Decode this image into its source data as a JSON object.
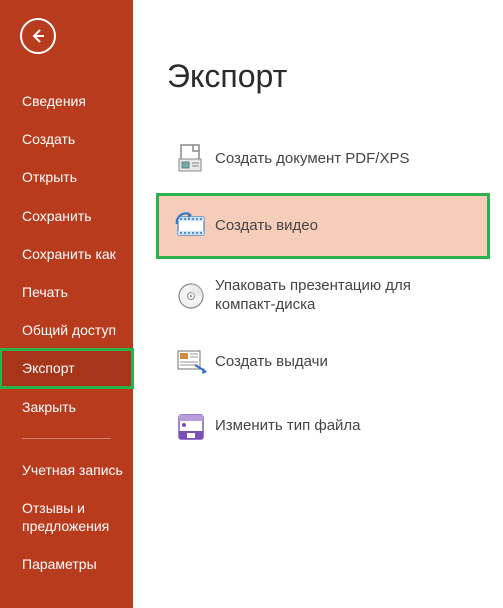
{
  "sidebar": {
    "items": [
      {
        "label": "Сведения"
      },
      {
        "label": "Создать"
      },
      {
        "label": "Открыть"
      },
      {
        "label": "Сохранить"
      },
      {
        "label": "Сохранить как"
      },
      {
        "label": "Печать"
      },
      {
        "label": "Общий доступ"
      },
      {
        "label": "Экспорт"
      },
      {
        "label": "Закрыть"
      },
      {
        "label": "Учетная запись"
      },
      {
        "label": "Отзывы и предложения"
      },
      {
        "label": "Параметры"
      }
    ]
  },
  "page": {
    "title": "Экспорт"
  },
  "export_options": [
    {
      "label": "Создать документ PDF/XPS",
      "icon": "pdf-xps-icon"
    },
    {
      "label": "Создать видео",
      "icon": "video-icon"
    },
    {
      "label": "Упаковать презентацию для компакт-диска",
      "icon": "cd-icon"
    },
    {
      "label": "Создать выдачи",
      "icon": "handouts-icon"
    },
    {
      "label": "Изменить тип файла",
      "icon": "filetype-icon"
    }
  ]
}
